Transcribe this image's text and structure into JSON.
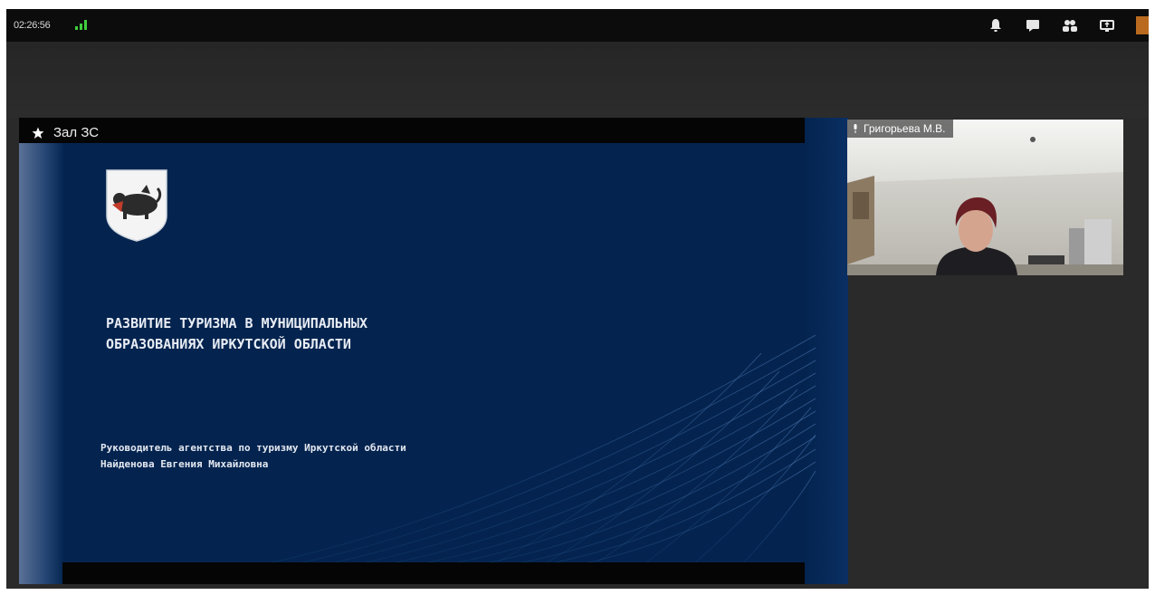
{
  "status_bar": {
    "time": "02:26:56"
  },
  "toolbar": {
    "icons": [
      "bell-icon",
      "chat-icon",
      "participants-icon",
      "share-screen-icon"
    ]
  },
  "shared_screen": {
    "label": "Зал ЗС",
    "slide": {
      "title_line1": "РАЗВИТИЕ ТУРИЗМА В МУНИЦИПАЛЬНЫХ",
      "title_line2": "ОБРАЗОВАНИЯХ ИРКУТСКОЙ ОБЛАСТИ",
      "author_line1": "Руководитель агентства по туризму Иркутской области",
      "author_line2": "Найденова Евгения Михайловна"
    }
  },
  "participant": {
    "name": "Григорьева М.В."
  },
  "colors": {
    "slide_background": "#04244f",
    "app_background": "#2a2a2a",
    "signal_green": "#3fcf3f"
  }
}
